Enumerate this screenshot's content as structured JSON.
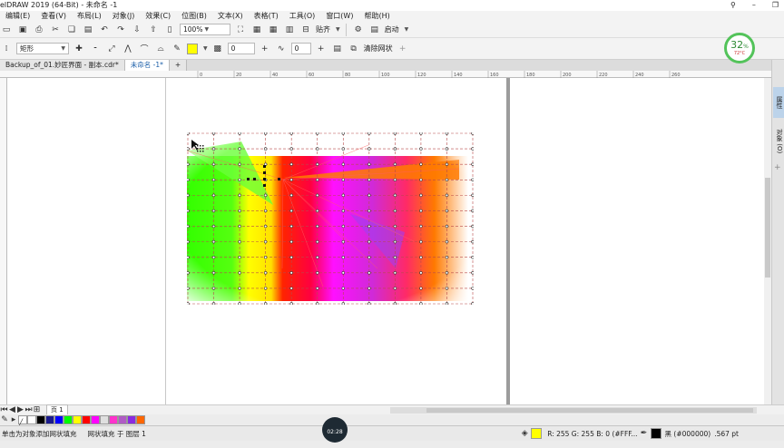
{
  "window": {
    "title": "elDRAW 2019 (64-Bit) - 未命名 -1"
  },
  "menu": [
    "编辑(E)",
    "查看(V)",
    "布局(L)",
    "对象(J)",
    "效果(C)",
    "位图(B)",
    "文本(X)",
    "表格(T)",
    "工具(O)",
    "窗口(W)",
    "帮助(H)"
  ],
  "toolbar": {
    "zoom": "100%",
    "snap_label": "贴齐",
    "launch_label": "启动"
  },
  "propbar": {
    "shape_select": "矩形",
    "smoothness_value": "0",
    "clear_mesh_label": "清除网状"
  },
  "tabs": [
    "Backup_of_01.妙匠界面 - 副本.cdr*",
    "未命名 -1*"
  ],
  "ruler": {
    "h_ticks": [
      "0",
      "20",
      "40",
      "60",
      "80",
      "100",
      "120",
      "140",
      "160",
      "180",
      "200",
      "220",
      "240",
      "260"
    ]
  },
  "right_dock": {
    "props_label": "属性",
    "objects_label": "对象 (O)"
  },
  "cpu": {
    "percent": "32",
    "unit": "%",
    "temp": "72°C"
  },
  "pagebar": {
    "page_label": "页 1"
  },
  "palette": [
    "#ffffff",
    "#000000",
    "#1a1a8c",
    "#0000ff",
    "#00ff00",
    "#ffff00",
    "#ff0000",
    "#ff00ff",
    "#dfdfdf",
    "#ff33cc",
    "#b05cc5",
    "#8a2be2",
    "#ff6600"
  ],
  "status": {
    "hint": "单击为对象添加网状填充",
    "object_info": "网状填充 于 图层 1",
    "fill_color": "#ffff00",
    "fill_readout": "R: 255 G: 255 B: 0 (#FFF...",
    "outline_label": "黑 (#000000)",
    "outline_width": ".567 pt"
  },
  "timer": "02:28"
}
